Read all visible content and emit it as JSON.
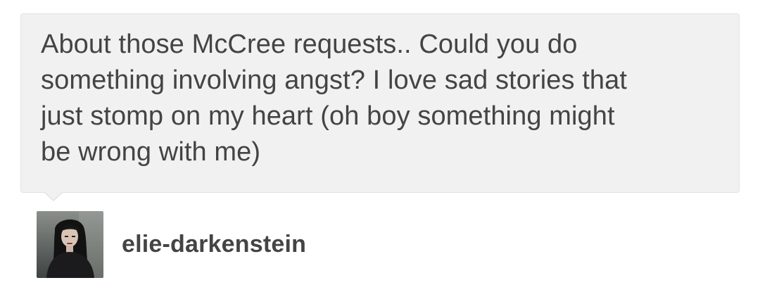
{
  "ask": {
    "lines": [
      "About those McCree requests.. Could you do",
      "something involving angst? I love sad stories that",
      "just stomp on my heart (oh boy something might",
      "be wrong with me)"
    ]
  },
  "author": {
    "username": "elie-darkenstein",
    "avatar_icon": "user-avatar-photo"
  },
  "colors": {
    "bubble_bg": "#f1f1f1",
    "bubble_border": "#e2e2e2",
    "text": "#444444"
  }
}
